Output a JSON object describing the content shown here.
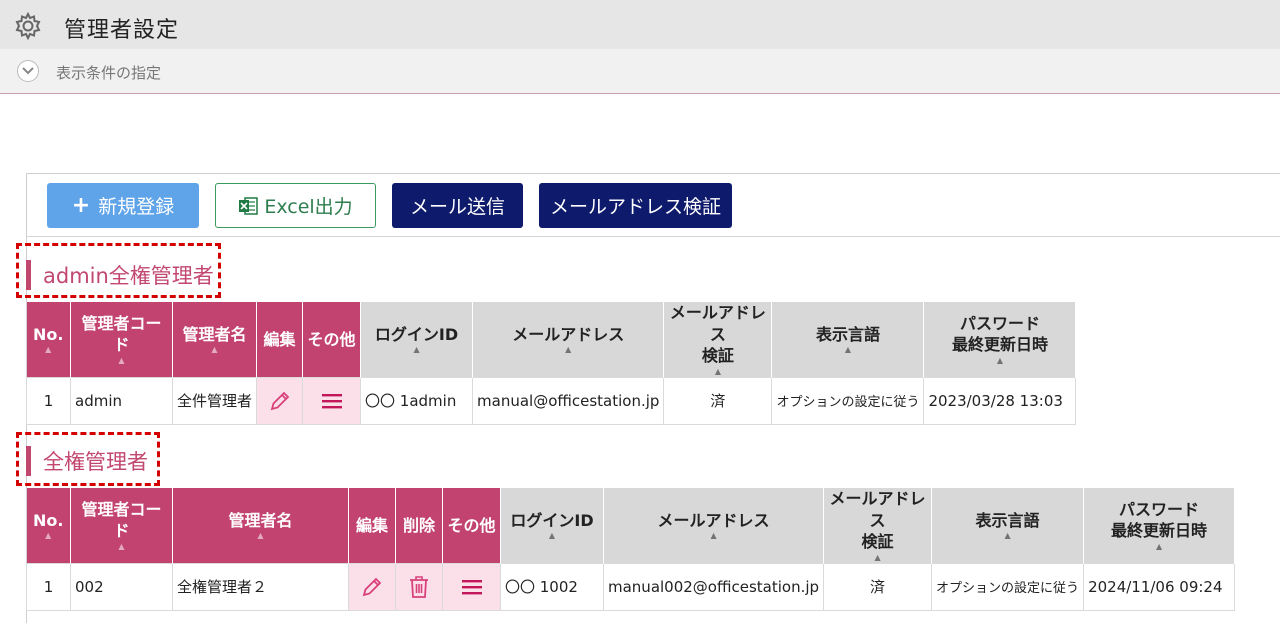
{
  "header": {
    "title": "管理者設定",
    "icon": "gear-icon"
  },
  "condition": {
    "label": "表示条件の指定",
    "icon": "chevron-down-icon"
  },
  "toolbar": {
    "new_label": "新規登録",
    "excel_label": "Excel出力",
    "mail_label": "メール送信",
    "verify_label": "メールアドレス検証"
  },
  "colors": {
    "accent": "#c2436f",
    "navy": "#0e1a6b",
    "blue": "#5fa3e8",
    "highlight": "#d40000"
  },
  "section1": {
    "title": "admin全権管理者",
    "headers": {
      "no": "No.",
      "code": "管理者コード",
      "name": "管理者名",
      "edit": "編集",
      "other": "その他",
      "login": "ログインID",
      "email": "メールアドレス",
      "verify_l1": "メールアドレス",
      "verify_l2": "検証",
      "lang": "表示言語",
      "pw_l1": "パスワード",
      "pw_l2": "最終更新日時"
    },
    "rows": [
      {
        "no": "1",
        "code": "admin",
        "name": "全件管理者",
        "login": "〇〇 1admin",
        "email": "manual@officestation.jp",
        "verify": "済",
        "lang": "オプションの設定に従う",
        "pw": "2023/03/28 13:03"
      }
    ]
  },
  "section2": {
    "title": "全権管理者",
    "headers": {
      "no": "No.",
      "code": "管理者コード",
      "name": "管理者名",
      "edit": "編集",
      "delete": "削除",
      "other": "その他",
      "login": "ログインID",
      "email": "メールアドレス",
      "verify_l1": "メールアドレス",
      "verify_l2": "検証",
      "lang": "表示言語",
      "pw_l1": "パスワード",
      "pw_l2": "最終更新日時"
    },
    "rows": [
      {
        "no": "1",
        "code": "002",
        "name": "全権管理者２",
        "login": "〇〇 1002",
        "email": "manual002@officestation.jp",
        "verify": "済",
        "lang": "オプションの設定に従う",
        "pw": "2024/11/06 09:24"
      }
    ]
  }
}
